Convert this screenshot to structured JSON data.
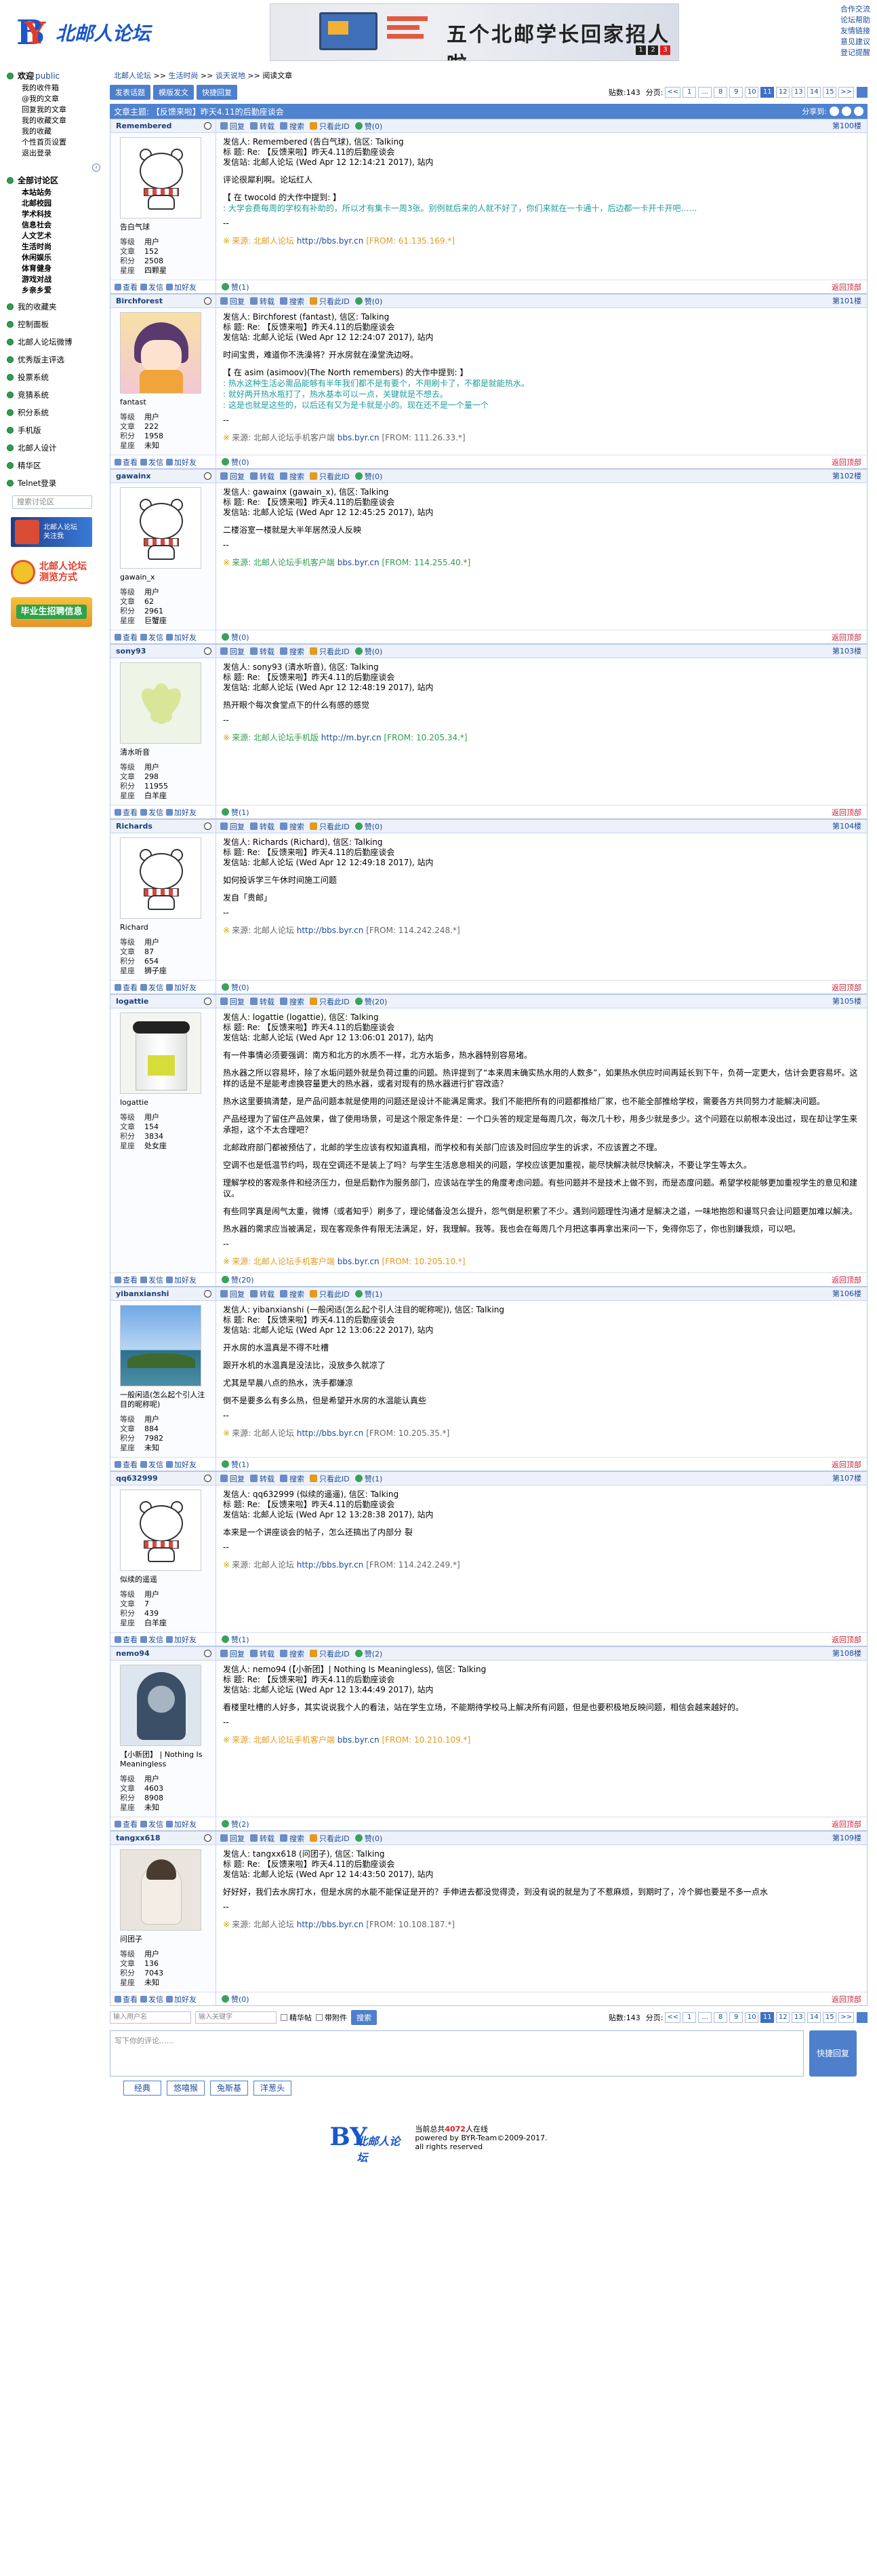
{
  "header": {
    "logo_text": "北邮人论坛",
    "banner_text": "五个北邮学长回家招人啦~",
    "banner_pages": [
      "1",
      "2",
      "3"
    ],
    "top_links": [
      "合作交流",
      "论坛帮助",
      "友情链接",
      "意见建议",
      "登记提醒"
    ]
  },
  "sidebar": {
    "welcome": "欢迎",
    "welcome_user": "public",
    "user_links": [
      "我的收件箱",
      "@我的文章",
      "回复我的文章",
      "我的收藏文章",
      "我的收藏",
      "个性首页设置",
      "退出登录"
    ],
    "forum_title": "全部讨论区",
    "forums": [
      "本站站务",
      "北邮校园",
      "学术科技",
      "信息社会",
      "人文艺术",
      "生活时尚",
      "休闲娱乐",
      "体育健身",
      "游戏对战",
      "乡亲乡爱"
    ],
    "favorites": "我的收藏夹",
    "items": [
      "控制面板",
      "北邮人论坛微博",
      "优秀版主评选",
      "投票系统",
      "竞猜系统",
      "积分系统",
      "手机版",
      "北邮人设计",
      "精华区",
      "Telnet登录"
    ],
    "search_placeholder": "搜索讨论区",
    "promo1": "北邮人论坛\n关注我",
    "promo2": "北邮人论坛\n测览方式",
    "promo3": "毕业生招聘信息"
  },
  "main": {
    "breadcrumb": [
      "北邮人论坛",
      "生活时尚",
      "谈天说地",
      "阅读文章"
    ],
    "buttons": [
      "发表话题",
      "模版发文",
      "快捷回复"
    ],
    "pager": {
      "count_label": "贴数:143",
      "pages_label": "分页:",
      "pages": [
        "<<",
        "1",
        "...",
        "8",
        "9",
        "10",
        "11",
        "12",
        "13",
        "14",
        "15",
        ">>"
      ],
      "current": "11"
    },
    "topic_label": "文章主题:",
    "topic_title": "【反馈来啦】昨天4.11的后勤座谈会",
    "share_label": "分享到:"
  },
  "post_actions": [
    "回复",
    "转载",
    "搜索",
    "只看此ID"
  ],
  "foot_actions": [
    "查看",
    "发信",
    "加好友"
  ],
  "back_top": "返回顶部",
  "posts": [
    {
      "user": "Remembered",
      "floor": "第100楼",
      "like_count": "赞(0)",
      "zan": "赞(1)",
      "avatar_style": "bear",
      "nick": "告白气球",
      "stats": {
        "level": "用户",
        "posts": "152",
        "score": "2508",
        "star": "四颗星"
      },
      "meta": [
        "发信人: Remembered (告白气球), 信区: Talking",
        "标  题: Re: 【反馈来啦】昨天4.11的后勤座谈会",
        "发信站: 北邮人论坛 (Wed Apr 12 12:14:21 2017), 站内"
      ],
      "paras": [
        "评论很犀利啊。论坛红人"
      ],
      "quote_head": "【 在 twocold 的大作中提到: 】",
      "quote": [
        ": 大学会费每周的学校有补助的，所以才有集卡一周3张。别例就后来的人就不好了，你们来就在一卡通十，后边都一卡开卡开吧……"
      ],
      "src": {
        "prefix": "来源: 北邮人论坛",
        "url": "http://bbs.byr.cn",
        "ip": "[FROM: 61.135.169.*]",
        "style": "orange"
      }
    },
    {
      "user": "Birchforest",
      "floor": "第101楼",
      "like_count": "赞(0)",
      "zan": "赞(0)",
      "avatar_style": "anime",
      "nick": "fantast",
      "stats": {
        "level": "用户",
        "posts": "222",
        "score": "1958",
        "star": "未知"
      },
      "meta": [
        "发信人: Birchforest (fantast), 信区: Talking",
        "标  题: Re: 【反馈来啦】昨天4.11的后勤座谈会",
        "发信站: 北邮人论坛 (Wed Apr 12 12:24:07 2017), 站内"
      ],
      "paras": [
        "时间宝贵，难道你不洗澡将？开水房就在澡堂洗边呀。"
      ],
      "quote_head": "【 在 asim (asimoov)(The North remembers) 的大作中提到: 】",
      "quote": [
        ": 热水这种生活必需品能够有半年我们都不是有要个，不用刷卡了，不都是就能热水。",
        ": 就好两开热水瓶打了，热水基本可以一点，关键就是不想去。",
        ": 这是也就是这些的，以后还有又为是卡就是小的。现在还不是一个量一个"
      ],
      "src": {
        "prefix": "来源: 北邮人论坛手机客户端",
        "url": "bbs.byr.cn",
        "ip": "[FROM: 111.26.33.*]",
        "style": "gray"
      }
    },
    {
      "user": "gawainx",
      "floor": "第102楼",
      "like_count": "赞(0)",
      "zan": "赞(0)",
      "avatar_style": "bear",
      "nick": "gawain_x",
      "stats": {
        "level": "用户",
        "posts": "62",
        "score": "2961",
        "star": "巨蟹座"
      },
      "meta": [
        "发信人: gawainx (gawain_x), 信区: Talking",
        "标  题: Re: 【反馈来啦】昨天4.11的后勤座谈会",
        "发信站: 北邮人论坛 (Wed Apr 12 12:45:25 2017), 站内"
      ],
      "paras": [
        "二楼浴室一楼就是大半年居然没人反映"
      ],
      "quote_head": "",
      "quote": [],
      "src": {
        "prefix": "来源: 北邮人论坛手机客户端",
        "url": "bbs.byr.cn",
        "ip": "[FROM: 114.255.40.*]",
        "style": "green"
      }
    },
    {
      "user": "sony93",
      "floor": "第103楼",
      "like_count": "赞(0)",
      "zan": "赞(1)",
      "avatar_style": "flower",
      "nick": "清水听音",
      "stats": {
        "level": "用户",
        "posts": "298",
        "score": "11955",
        "star": "白羊座"
      },
      "meta": [
        "发信人: sony93 (清水听音), 信区: Talking",
        "标  题: Re: 【反馈来啦】昨天4.11的后勤座谈会",
        "发信站: 北邮人论坛 (Wed Apr 12 12:48:19 2017), 站内"
      ],
      "paras": [
        "热开眼个每次食堂点下的什么有感的感觉"
      ],
      "quote_head": "",
      "quote": [],
      "src": {
        "prefix": "来源: 北邮人论坛手机版",
        "url": "http://m.byr.cn",
        "ip": "[FROM: 10.205.34.*]",
        "style": "green"
      }
    },
    {
      "user": "Richards",
      "floor": "第104楼",
      "like_count": "赞(0)",
      "zan": "赞(0)",
      "avatar_style": "bear",
      "nick": "Richard",
      "stats": {
        "level": "用户",
        "posts": "87",
        "score": "654",
        "star": "狮子座"
      },
      "meta": [
        "发信人: Richards (Richard), 信区: Talking",
        "标  题: Re: 【反馈来啦】昨天4.11的后勤座谈会",
        "发信站: 北邮人论坛 (Wed Apr 12 12:49:18 2017), 站内"
      ],
      "paras": [
        "如何投诉学三午休时间施工问题",
        "发自「贵邮」"
      ],
      "quote_head": "",
      "quote": [],
      "src": {
        "prefix": "来源: 北邮人论坛",
        "url": "http://bbs.byr.cn",
        "ip": "[FROM: 114.242.248.*]",
        "style": "gray"
      }
    },
    {
      "user": "logattie",
      "floor": "第105楼",
      "like_count": "赞(20)",
      "zan": "赞(20)",
      "avatar_style": "bottle",
      "nick": "logattie",
      "stats": {
        "level": "用户",
        "posts": "154",
        "score": "3834",
        "star": "处女座"
      },
      "meta": [
        "发信人: logattie (logattie), 信区: Talking",
        "标  题: Re: 【反馈来啦】昨天4.11的后勤座谈会",
        "发信站: 北邮人论坛 (Wed Apr 12 13:06:01 2017), 站内"
      ],
      "paras": [
        "有一件事情必须要强调：南方和北方的水质不一样，北方水垢多，热水器特别容易堵。",
        "热水器之所以容易坏，除了水垢问题外就是负荷过重的问题。热评提到了“本来周末确实热水用的人数多”，如果热水供应时间再延长到下午，负荷一定更大，估计会更容易坏。这样的话是不是能考虑换容量更大的热水器，或者对现有的热水器进行扩容改造？",
        "热水这里要搞清楚，是产品问题本就是使用的问题还是设计不能满足需求。我们不能把所有的问题都推给厂家，也不能全部推给学校，需要各方共同努力才能解决问题。",
        "产品经理为了留住产品效果，做了使用场景，可是这个限定条件是：一个口头答的规定是每周几次，每次几十秒，用多少就是多少。这个问题在以前根本没出过，现在却让学生来承担，这个不太合理吧？",
        "北邮政府部门都被预估了，北邮的学生应该有权知道真相，而学校和有关部门应该及时回应学生的诉求，不应该置之不理。",
        "空调不也是低温节约吗，现在空调还不是装上了吗？与学生生活息息相关的问题，学校应该更加重视，能尽快解决就尽快解决，不要让学生等太久。",
        "理解学校的客观条件和经济压力，但是后勤作为服务部门，应该站在学生的角度考虑问题。有些问题并不是技术上做不到，而是态度问题。希望学校能够更加重视学生的意见和建议。",
        "有些同学真是闹气太重，微博（或者知乎）刷多了，理论储备没怎么提升，怨气倒是积累了不少。遇到问题理性沟通才是解决之道，一味地抱怨和谩骂只会让问题更加难以解决。",
        "热水器的需求应当被满足，现在客观条件有限无法满足，好，我理解。我等。我也会在每周几个月把这事再拿出来问一下，免得你忘了，你也别嫌我烦，可以吧。"
      ],
      "quote_head": "",
      "quote": [],
      "src": {
        "prefix": "来源: 北邮人论坛手机客户端",
        "url": "bbs.byr.cn",
        "ip": "[FROM: 10.205.10.*]",
        "style": "orange"
      }
    },
    {
      "user": "yibanxianshi",
      "floor": "第106楼",
      "like_count": "赞(1)",
      "zan": "赞(1)",
      "avatar_style": "scene",
      "nick": "一般闲适(怎么起个引人注目的昵称呢)",
      "stats": {
        "level": "用户",
        "posts": "884",
        "score": "7982",
        "star": "未知"
      },
      "meta": [
        "发信人: yibanxianshi (一般闲适(怎么起个引人注目的昵称呢)), 信区: Talking",
        "标  题: Re: 【反馈来啦】昨天4.11的后勤座谈会",
        "发信站: 北邮人论坛 (Wed Apr 12 13:06:22 2017), 站内"
      ],
      "paras": [
        "开水房的水温真是不得不吐槽",
        "跟开水机的水温真是没法比，没放多久就凉了",
        "尤其是早晨八点的热水，洗手都嫌凉",
        "倒不是要多么有多么热，但是希望开水房的水温能认真些"
      ],
      "quote_head": "",
      "quote": [],
      "src": {
        "prefix": "来源: 北邮人论坛",
        "url": "http://bbs.byr.cn",
        "ip": "[FROM: 10.205.35.*]",
        "style": "gray"
      }
    },
    {
      "user": "qq632999",
      "floor": "第107楼",
      "like_count": "赞(1)",
      "zan": "赞(1)",
      "avatar_style": "bear",
      "nick": "似续的遥遥",
      "stats": {
        "level": "用户",
        "posts": "7",
        "score": "439",
        "star": "白羊座"
      },
      "meta": [
        "发信人: qq632999 (似续的遥遥), 信区: Talking",
        "标  题: Re: 【反馈来啦】昨天4.11的后勤座谈会",
        "发信站: 北邮人论坛 (Wed Apr 12 13:28:38 2017), 站内"
      ],
      "paras": [
        "本来是一个讲座谈会的帖子，怎么还搞出了内部分 裂"
      ],
      "quote_head": "",
      "quote": [],
      "src": {
        "prefix": "来源: 北邮人论坛",
        "url": "http://bbs.byr.cn",
        "ip": "[FROM: 114.242.249.*]",
        "style": "gray"
      }
    },
    {
      "user": "nemo94",
      "floor": "第108楼",
      "like_count": "赞(2)",
      "zan": "赞(2)",
      "avatar_style": "hood",
      "nick": "【小新团】 | Nothing Is Meaningless",
      "stats": {
        "level": "用户",
        "posts": "4603",
        "score": "8908",
        "star": "未知"
      },
      "meta": [
        "发信人: nemo94 (【小新团】| Nothing Is Meaningless), 信区: Talking",
        "标  题: Re: 【反馈来啦】昨天4.11的后勤座谈会",
        "发信站: 北邮人论坛 (Wed Apr 12 13:44:49 2017), 站内"
      ],
      "paras": [
        "看楼里吐槽的人好多，其实说说我个人的看法，站在学生立场，不能期待学校马上解决所有问题，但是也要积极地反映问题，相信会越来越好的。"
      ],
      "quote_head": "",
      "quote": [],
      "src": {
        "prefix": "来源: 北邮人论坛手机客户端",
        "url": "bbs.byr.cn",
        "ip": "[FROM: 10.210.109.*]",
        "style": "orange"
      }
    },
    {
      "user": "tangxx618",
      "floor": "第109楼",
      "like_count": "赞(0)",
      "zan": "赞(0)",
      "avatar_style": "girl",
      "nick": "问团子",
      "stats": {
        "level": "用户",
        "posts": "136",
        "score": "7043",
        "star": "未知"
      },
      "meta": [
        "发信人: tangxx618 (问团子), 信区: Talking",
        "标  题: Re: 【反馈来啦】昨天4.11的后勤座谈会",
        "发信站: 北邮人论坛 (Wed Apr 12 14:43:50 2017), 站内"
      ],
      "paras": [
        "好好好，我们去水房打水，但是水房的水能不能保证是开的？手伸进去都没觉得烫，到没有说的就是为了不惹麻烦，到期时了，冷个脚也要是不多一点水"
      ],
      "quote_head": "",
      "quote": [],
      "src": {
        "prefix": "来源: 北邮人论坛",
        "url": "http://bbs.byr.cn",
        "ip": "[FROM: 10.108.187.*]",
        "style": "gray"
      }
    }
  ],
  "bottom": {
    "user_placeholder": "输入用户名",
    "search_placeholder": "输入关键字",
    "checks": [
      "精华帖",
      "带附件"
    ],
    "search_btn": "搜索",
    "reply_placeholder": "写下你的评论......",
    "send_label": "快捷回复",
    "quick_buttons": [
      "经典",
      "悠嘻猴",
      "兔斯基",
      "洋葱头"
    ]
  },
  "footer": {
    "logo_text": "北邮人论坛",
    "online_prefix": "当前总共",
    "online_count": "4072",
    "online_suffix": "人在线",
    "powered": "powered by BYR-Team©2009-2017.",
    "rights": "all rights reserved"
  }
}
